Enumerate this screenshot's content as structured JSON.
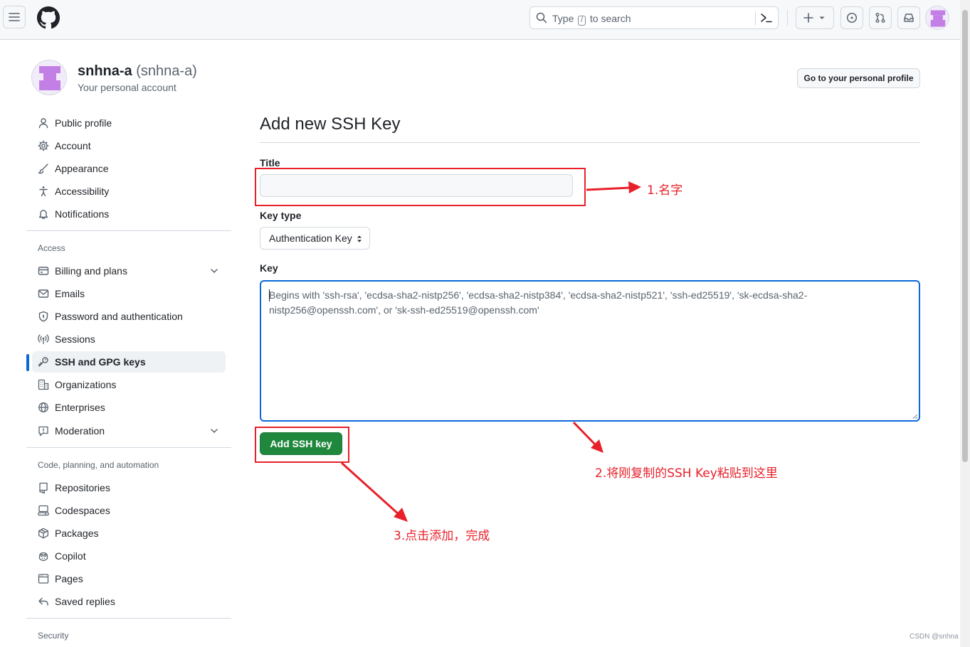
{
  "header": {
    "search_prefix": "Type",
    "search_key": "/",
    "search_suffix": "to search",
    "icons": [
      "menu-icon",
      "github-logo",
      "search-icon",
      "command-palette-icon",
      "plus-icon",
      "triangle-down-icon",
      "issue-icon",
      "pull-request-icon",
      "inbox-icon"
    ]
  },
  "user": {
    "name": "snhna-a",
    "handle": "(snhna-a)",
    "subtitle": "Your personal account",
    "profile_button": "Go to your personal profile"
  },
  "sidebar": {
    "items": [
      {
        "label": "Public profile",
        "icon": "person-icon"
      },
      {
        "label": "Account",
        "icon": "gear-icon"
      },
      {
        "label": "Appearance",
        "icon": "paintbrush-icon"
      },
      {
        "label": "Accessibility",
        "icon": "accessibility-icon"
      },
      {
        "label": "Notifications",
        "icon": "bell-icon"
      }
    ],
    "access_heading": "Access",
    "access_items": [
      {
        "label": "Billing and plans",
        "icon": "credit-card-icon",
        "expandable": true
      },
      {
        "label": "Emails",
        "icon": "mail-icon"
      },
      {
        "label": "Password and authentication",
        "icon": "shield-lock-icon"
      },
      {
        "label": "Sessions",
        "icon": "broadcast-icon"
      },
      {
        "label": "SSH and GPG keys",
        "icon": "key-icon",
        "active": true
      },
      {
        "label": "Organizations",
        "icon": "organization-icon"
      },
      {
        "label": "Enterprises",
        "icon": "globe-icon"
      },
      {
        "label": "Moderation",
        "icon": "report-icon",
        "expandable": true
      }
    ],
    "code_heading": "Code, planning, and automation",
    "code_items": [
      {
        "label": "Repositories",
        "icon": "repo-icon"
      },
      {
        "label": "Codespaces",
        "icon": "codespaces-icon"
      },
      {
        "label": "Packages",
        "icon": "package-icon"
      },
      {
        "label": "Copilot",
        "icon": "copilot-icon"
      },
      {
        "label": "Pages",
        "icon": "browser-icon"
      },
      {
        "label": "Saved replies",
        "icon": "reply-icon"
      }
    ],
    "security_heading": "Security"
  },
  "main": {
    "title": "Add new SSH Key",
    "title_label": "Title",
    "title_value": "",
    "key_type_label": "Key type",
    "key_type_value": "Authentication Key",
    "key_label": "Key",
    "key_placeholder": "Begins with 'ssh-rsa', 'ecdsa-sha2-nistp256', 'ecdsa-sha2-nistp384', 'ecdsa-sha2-nistp521', 'ssh-ed25519', 'sk-ecdsa-sha2-nistp256@openssh.com', or 'sk-ssh-ed25519@openssh.com'",
    "submit_label": "Add SSH key"
  },
  "annotations": {
    "note1": "1.名字",
    "note2": "2.将刚复制的SSH Key粘贴到这里",
    "note3": "3.点击添加，完成",
    "color": "#e8202a"
  },
  "watermark": "CSDN @snhna",
  "colors": {
    "accent": "#0969da",
    "primary_button": "#1f883d",
    "header_bg": "#f6f8fa",
    "border": "#d1d9e0"
  }
}
